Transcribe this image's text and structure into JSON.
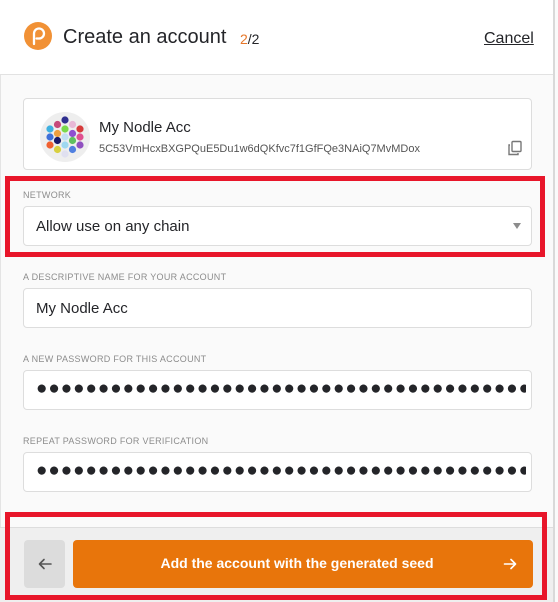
{
  "header": {
    "title": "Create an account",
    "step_current": "2",
    "step_total": "/2",
    "cancel_label": "Cancel",
    "logo_icon": "polkadot-logo-icon"
  },
  "account": {
    "name": "My Nodle Acc",
    "address": "5C53VmHcxBXGPQuE5Du1w6dQKfvc7f1GfFQe3NAiQ7MvMDox",
    "copy_icon": "copy-icon"
  },
  "network": {
    "label": "NETWORK",
    "selected": "Allow use on any chain"
  },
  "name_field": {
    "label": "A DESCRIPTIVE NAME FOR YOUR ACCOUNT",
    "value": "My Nodle Acc"
  },
  "password": {
    "label": "A NEW PASSWORD FOR THIS ACCOUNT",
    "masked_value": "●●●●●●●●●●●●●●●●●●●●●●●●●●●●●●●●●●●●●●●●●●●●●●●●●●●●●●●●●●●●●●●●"
  },
  "repeat_password": {
    "label": "REPEAT PASSWORD FOR VERIFICATION",
    "masked_value": "●●●●●●●●●●●●●●●●●●●●●●●●●●●●●●●●●●●●●●●●●●●●●●●●●●●●●●●●●●●●●●●●"
  },
  "footer": {
    "back_icon": "arrow-left-icon",
    "submit_label": "Add the account with the generated seed",
    "submit_icon": "arrow-right-icon"
  },
  "colors": {
    "accent": "#e8750b",
    "highlight": "#e8162a",
    "logo": "#f19135"
  }
}
